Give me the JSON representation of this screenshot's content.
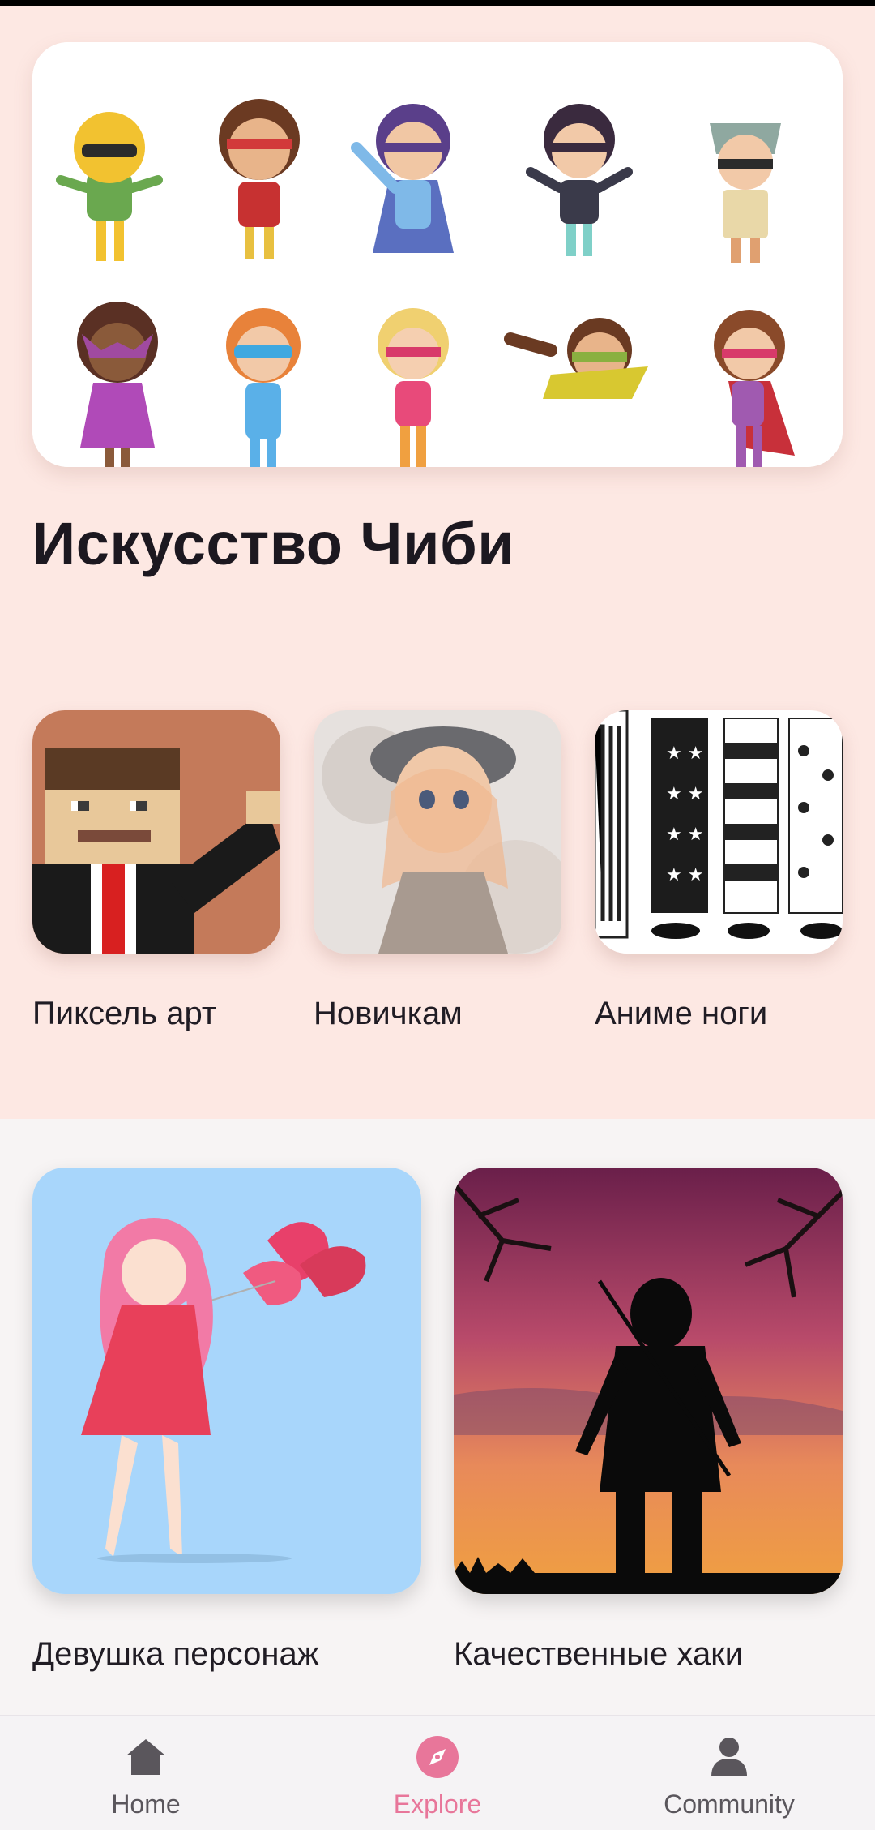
{
  "section": {
    "title": "Искусство Чиби"
  },
  "categories": [
    {
      "label": "Пиксель арт"
    },
    {
      "label": "Новичкам"
    },
    {
      "label": "Аниме ноги"
    }
  ],
  "features": [
    {
      "label": "Девушка персонаж"
    },
    {
      "label": "Качественные хаки"
    }
  ],
  "nav": {
    "items": [
      {
        "label": "Home",
        "icon": "home-icon"
      },
      {
        "label": "Explore",
        "icon": "compass-icon",
        "active": true
      },
      {
        "label": "Community",
        "icon": "person-icon"
      }
    ]
  },
  "colors": {
    "accent": "#e8769a",
    "section_bg": "#fde8e3",
    "page_bg": "#f7f4f4"
  }
}
